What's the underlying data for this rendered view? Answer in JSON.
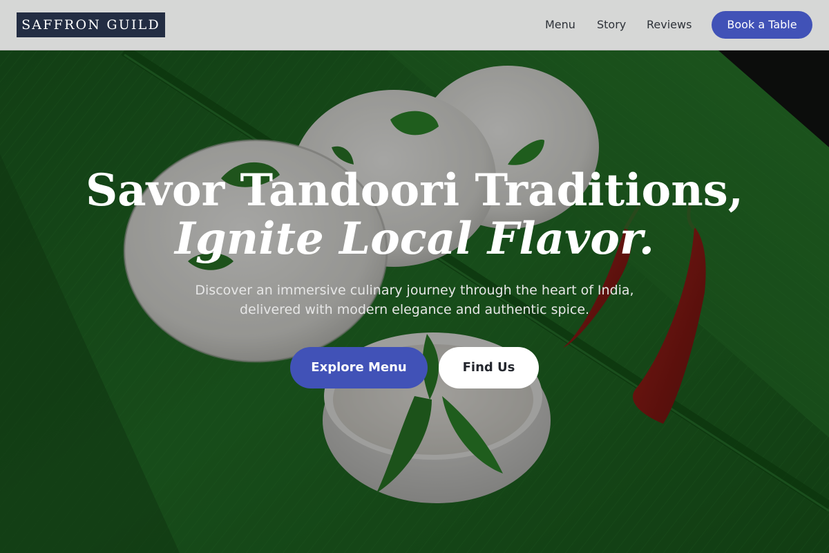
{
  "brand": {
    "name": "SAFFRON GUILD"
  },
  "nav": {
    "items": [
      {
        "label": "Menu"
      },
      {
        "label": "Story"
      },
      {
        "label": "Reviews"
      }
    ],
    "cta_label": "Book a Table"
  },
  "hero": {
    "headline_line1": "Savor Tandoori Traditions,",
    "headline_line2": "Ignite Local Flavor.",
    "subtitle_line1": "Discover an immersive culinary journey through the heart of India,",
    "subtitle_line2": "delivered with modern elegance and authentic spice.",
    "primary_button": "Explore Menu",
    "secondary_button": "Find Us",
    "image_subject": "idli with coconut chutney, curry leaves and dried red chilies on a banana leaf"
  },
  "colors": {
    "accent": "#4152b7",
    "logo_background": "#232d43",
    "header_background": "#d6d7d6",
    "banana_leaf": "#1f6a22"
  }
}
